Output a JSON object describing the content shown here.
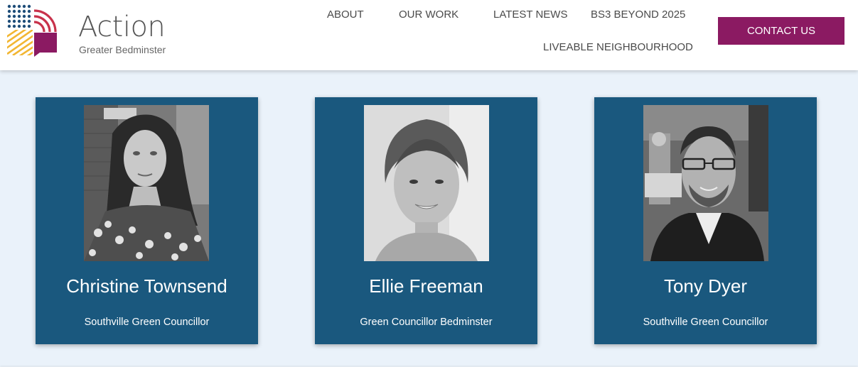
{
  "logo": {
    "title": "Action",
    "subtitle": "Greater Bedminster",
    "icon": "action-greater-bedminster-logo-icon",
    "colors": {
      "navy": "#1f4e79",
      "red": "#c8324b",
      "yellow": "#f2b632",
      "plum": "#8b1a62"
    }
  },
  "nav": {
    "items": [
      {
        "label": "ABOUT"
      },
      {
        "label": "OUR WORK"
      },
      {
        "label": "LATEST NEWS"
      },
      {
        "label": "BS3 BEYOND 2025"
      },
      {
        "label": "LIVEABLE NEIGHBOURHOOD"
      }
    ],
    "contact_label": "CONTACT US"
  },
  "people": [
    {
      "name": "Christine Townsend",
      "role": "Southville Green Councillor",
      "photo": "portrait-photo"
    },
    {
      "name": "Ellie Freeman",
      "role": "Green Councillor Bedminster",
      "photo": "portrait-photo"
    },
    {
      "name": "Tony Dyer",
      "role": "Southville Green Councillor",
      "photo": "portrait-photo"
    }
  ],
  "colors": {
    "card": "#1a587e",
    "content_background": "#eaf2fa",
    "contact_button": "#8b1a62",
    "nav_text": "#4a4a4a"
  }
}
